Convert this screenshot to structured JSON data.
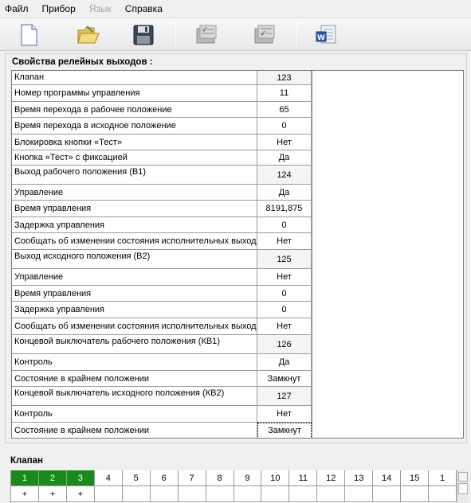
{
  "menu": [
    "Файл",
    "Прибор",
    "Язык",
    "Справка"
  ],
  "menu_disabled": [
    false,
    false,
    true,
    false
  ],
  "toolbar": {
    "buttons": [
      "new-document-icon",
      "open-folder-icon",
      "save-floppy-icon",
      "copy-list-icon",
      "paste-list-icon",
      "word-export-icon"
    ]
  },
  "panel": {
    "title": "Свойства релейных выходов :",
    "rows": [
      {
        "name": "Клапан",
        "value": "123",
        "group": true
      },
      {
        "name": "Номер программы управления",
        "value": "11"
      },
      {
        "name": "Время перехода в рабочее положение",
        "value": "65"
      },
      {
        "name": "Время перехода в исходное положение",
        "value": "0"
      },
      {
        "name": "Блокировка кнопки «Тест»",
        "value": "Нет"
      },
      {
        "name": "Кнопка «Тест» с фиксацией",
        "value": "Да"
      },
      {
        "name": "Выход рабочего положения (В1)",
        "value": "124",
        "group": true
      },
      {
        "name": "Управление",
        "value": "Да"
      },
      {
        "name": "Время управления",
        "value": "8191,875"
      },
      {
        "name": "Задержка управления",
        "value": "0"
      },
      {
        "name": "Сообщать об изменении состояния исполнительных выходов",
        "value": "Нет"
      },
      {
        "name": "Выход исходного положения (В2)",
        "value": "125",
        "group": true
      },
      {
        "name": "Управление",
        "value": "Нет"
      },
      {
        "name": "Время управления",
        "value": "0"
      },
      {
        "name": "Задержка управления",
        "value": "0"
      },
      {
        "name": "Сообщать об изменении состояния исполнительных выходов",
        "value": "Нет"
      },
      {
        "name": "Концевой выключатель рабочего положения (КВ1)",
        "value": "126",
        "group": true
      },
      {
        "name": "Контроль",
        "value": "Да"
      },
      {
        "name": "Состояние в крайнем положении",
        "value": "Замкнут"
      },
      {
        "name": "Концевой выключатель исходного положения (КВ2)",
        "value": "127",
        "group": true
      },
      {
        "name": "Контроль",
        "value": "Нет"
      },
      {
        "name": "Состояние в крайнем положении",
        "value": "Замкнут",
        "selected": true
      }
    ]
  },
  "bottom": {
    "title": "Клапан",
    "columns": [
      "1",
      "2",
      "3",
      "4",
      "5",
      "6",
      "7",
      "8",
      "9",
      "10",
      "11",
      "12",
      "13",
      "14",
      "15",
      "1"
    ],
    "active": [
      true,
      true,
      true,
      false,
      false,
      false,
      false,
      false,
      false,
      false,
      false,
      false,
      false,
      false,
      false,
      false
    ],
    "marks": [
      "+",
      "+",
      "+",
      "",
      "",
      "",
      "",
      "",
      "",
      "",
      "",
      "",
      "",
      "",
      "",
      ""
    ]
  }
}
